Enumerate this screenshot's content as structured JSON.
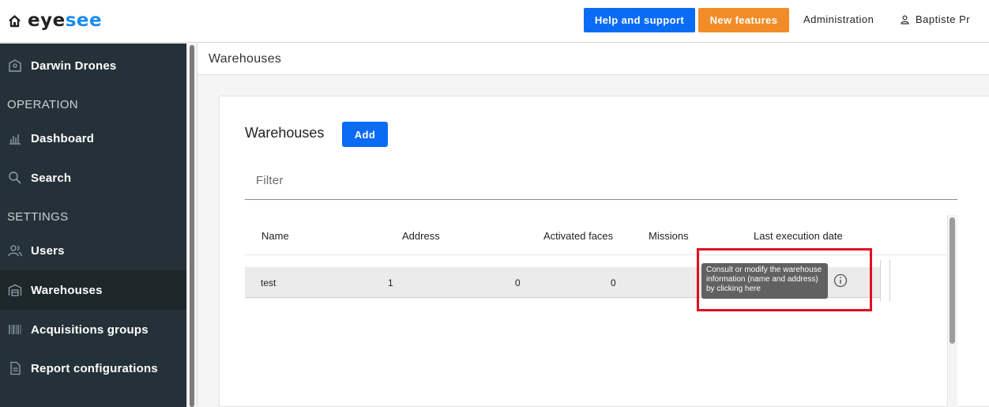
{
  "header": {
    "logo": {
      "part1": "eye",
      "part2": "see"
    },
    "help_label": "Help and support",
    "new_features_label": "New features",
    "admin_label": "Administration",
    "user_label": "Baptiste Pr"
  },
  "sidebar": {
    "company": "Darwin Drones",
    "section_operation": "OPERATION",
    "dashboard": "Dashboard",
    "search": "Search",
    "section_settings": "SETTINGS",
    "users": "Users",
    "warehouses": "Warehouses",
    "acquisitions_groups": "Acquisitions groups",
    "report_configurations": "Report configurations"
  },
  "main": {
    "breadcrumb": "Warehouses",
    "card_title": "Warehouses",
    "add_label": "Add",
    "filter_placeholder": "Filter",
    "columns": [
      "Name",
      "Address",
      "Activated faces",
      "Missions",
      "Last execution date"
    ],
    "rows": [
      {
        "name": "test",
        "address": "1",
        "activated_faces": "0",
        "missions": "0"
      }
    ],
    "tooltip": "Consult or modify the warehouse information (name and address) by clicking here"
  },
  "colors": {
    "primary": "#0a6cf5",
    "orange": "#f28c28",
    "sidebar_bg": "#253138",
    "highlight": "#e0101e"
  }
}
